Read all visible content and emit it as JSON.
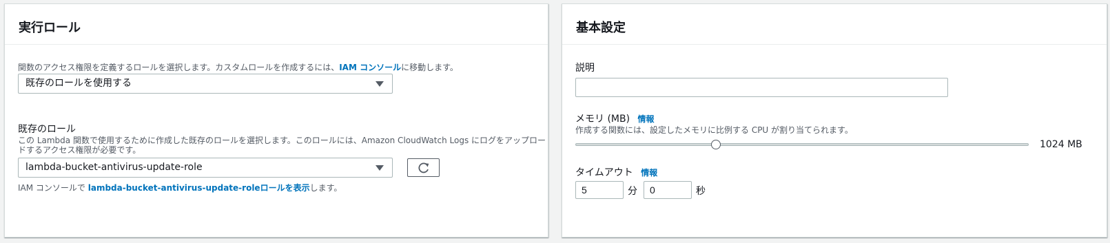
{
  "execution_role": {
    "title": "実行ロール",
    "description_prefix": "関数のアクセス権限を定義するロールを選択します。カスタムロールを作成するには、",
    "iam_console_link": "IAM コンソール",
    "description_suffix": "に移動します。",
    "role_type_selected": "既存のロールを使用する",
    "existing_role_label": "既存のロール",
    "existing_role_desc_line1": "この Lambda 関数で使用するために作成した既存のロールを選択します。このロールには、Amazon CloudWatch Logs にログをアップロー",
    "existing_role_desc_line2": "ドするアクセス権限が必要です。",
    "existing_role_selected": "lambda-bucket-antivirus-update-role",
    "footer_prefix": "IAM コンソールで ",
    "footer_link": "lambda-bucket-antivirus-update-roleロールを表示",
    "footer_suffix": "します。"
  },
  "basic_settings": {
    "title": "基本設定",
    "description_label": "説明",
    "description_value": "",
    "memory_label": "メモリ (MB)",
    "memory_info": "情報",
    "memory_desc": "作成する関数には、設定したメモリに比例する CPU が割り当てられます。",
    "memory_value_text": "1024 MB",
    "memory_fraction": 0.31,
    "timeout_label": "タイムアウト",
    "timeout_info": "情報",
    "timeout_minutes": "5",
    "minutes_unit": "分",
    "timeout_seconds": "0",
    "seconds_unit": "秒"
  },
  "icons": {
    "refresh": "refresh-icon",
    "caret": "caret-down-icon"
  },
  "colors": {
    "link": "#0073bb",
    "text": "#16191f",
    "muted": "#545b64"
  }
}
